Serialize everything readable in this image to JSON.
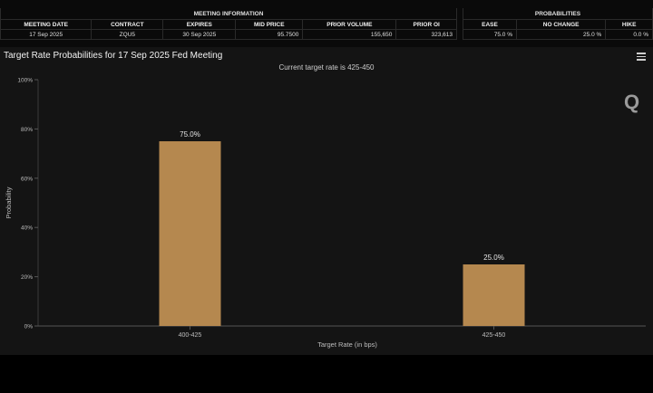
{
  "meeting_info": {
    "group_label": "MEETING INFORMATION",
    "headers": [
      "MEETING DATE",
      "CONTRACT",
      "EXPIRES",
      "MID PRICE",
      "PRIOR VOLUME",
      "PRIOR OI"
    ],
    "values": [
      "17 Sep 2025",
      "ZQU5",
      "30 Sep 2025",
      "95.7500",
      "155,650",
      "323,613"
    ]
  },
  "probabilities": {
    "group_label": "PROBABILITIES",
    "headers": [
      "EASE",
      "NO CHANGE",
      "HIKE"
    ],
    "values": [
      "75.0 %",
      "25.0 %",
      "0.0 %"
    ]
  },
  "chart": {
    "title": "Target Rate Probabilities for 17 Sep 2025 Fed Meeting",
    "subtitle": "Current target rate is 425-450",
    "logo": "Q"
  },
  "chart_data": {
    "type": "bar",
    "title": "Target Rate Probabilities for 17 Sep 2025 Fed Meeting",
    "subtitle": "Current target rate is 425-450",
    "categories": [
      "400-425",
      "425-450"
    ],
    "values": [
      75.0,
      25.0
    ],
    "data_labels": [
      "75.0%",
      "25.0%"
    ],
    "xlabel": "Target Rate (in bps)",
    "ylabel": "Probability",
    "ylim": [
      0,
      100
    ],
    "yticks": [
      "0%",
      "20%",
      "40%",
      "60%",
      "80%",
      "100%"
    ],
    "bar_color": "#b5884f",
    "grid": false
  }
}
